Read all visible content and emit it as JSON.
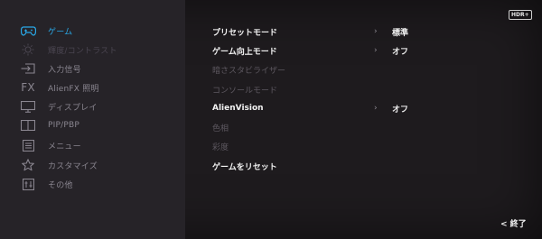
{
  "sidebar": {
    "items": [
      {
        "label": "ゲーム",
        "icon": "gamepad-icon",
        "state": "active"
      },
      {
        "label": "輝度/コントラスト",
        "icon": "brightness-icon",
        "state": "dim"
      },
      {
        "label": "入力信号",
        "icon": "input-icon",
        "state": "normal"
      },
      {
        "label": "AlienFX 照明",
        "icon": "fx-icon",
        "state": "normal"
      },
      {
        "label": "ディスプレイ",
        "icon": "monitor-icon",
        "state": "normal"
      },
      {
        "label": "PIP/PBP",
        "icon": "pip-icon",
        "state": "normal"
      },
      {
        "label": "メニュー",
        "icon": "menu-icon",
        "state": "normal"
      },
      {
        "label": "カスタマイズ",
        "icon": "star-icon",
        "state": "normal"
      },
      {
        "label": "その他",
        "icon": "others-icon",
        "state": "normal"
      }
    ]
  },
  "main": {
    "items": [
      {
        "label": "プリセットモード",
        "value": "標準",
        "enabled": true
      },
      {
        "label": "ゲーム向上モード",
        "value": "オフ",
        "enabled": true
      },
      {
        "label": "暗さスタビライザー",
        "value": "",
        "enabled": false
      },
      {
        "label": "コンソールモード",
        "value": "",
        "enabled": false
      },
      {
        "label": "AlienVision",
        "value": "オフ",
        "enabled": true
      },
      {
        "label": "色相",
        "value": "",
        "enabled": false
      },
      {
        "label": "彩度",
        "value": "",
        "enabled": false
      },
      {
        "label": "ゲームをリセット",
        "value": "",
        "enabled": true
      }
    ],
    "chevron": "›"
  },
  "badge": {
    "label": "HDR+"
  },
  "footer": {
    "exit_label": "< 終了"
  },
  "colors": {
    "accent": "#29a9e8",
    "background": "#1e1b1e",
    "sidebar": "#262328"
  }
}
